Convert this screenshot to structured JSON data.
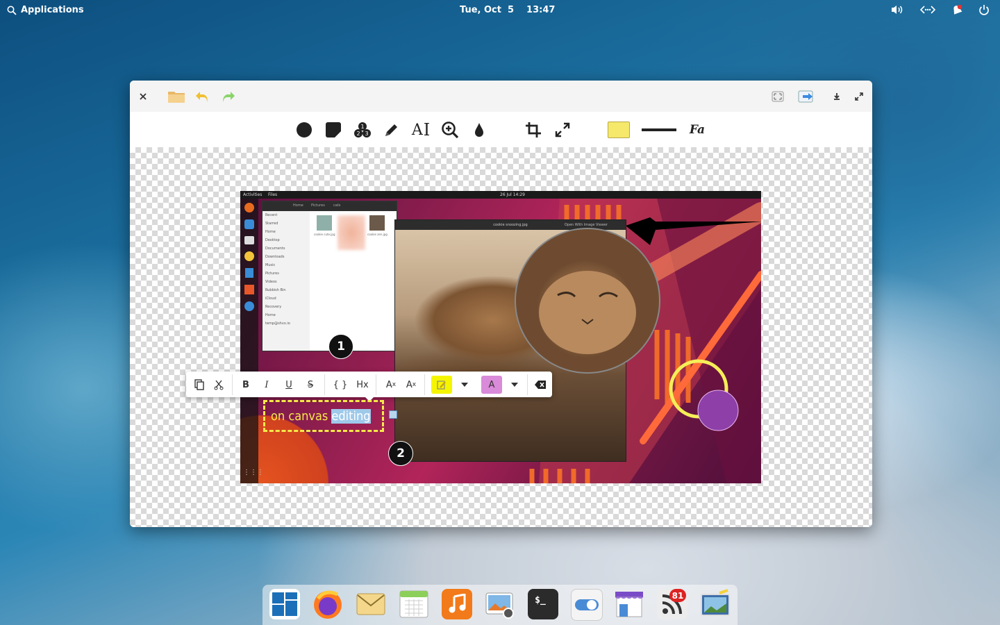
{
  "panel": {
    "applications_label": "Applications",
    "date": "Tue, Oct  5",
    "time": "13:47",
    "icons": [
      "search-icon",
      "volume-icon",
      "network-icon",
      "notifications-icon",
      "power-icon"
    ]
  },
  "window": {
    "headerbar_icons": [
      "close-icon",
      "folder-icon",
      "undo-icon",
      "redo-icon",
      "fit-icon",
      "export-icon",
      "download-icon",
      "fullscreen-icon"
    ],
    "tools": [
      "circle-icon",
      "square-icon",
      "counter-icon",
      "pen-icon",
      "text-icon",
      "magnifier-icon",
      "blur-icon",
      "crop-icon",
      "resize-icon",
      "color-swatch",
      "stroke-width",
      "font-icon"
    ],
    "tool_text_label": "A",
    "font_label": "Fa",
    "primary_color": "#f5e86a"
  },
  "image": {
    "activities": "Activities",
    "files": "Files",
    "clock": "26 Jul  14:29",
    "path": [
      "Home",
      "Pictures",
      "cats"
    ],
    "sidebar": [
      "Recent",
      "Starred",
      "Home",
      "Desktop",
      "Documents",
      "Downloads",
      "Music",
      "Pictures",
      "Videos",
      "Rubbish Bin",
      "iCloud",
      "Recovery",
      "Home",
      "temp@shvx.io"
    ],
    "thumbs": [
      "cookie cute.jpg",
      "",
      "cookie zen.jpg"
    ],
    "viewer_title": "cookie snoozing.jpg",
    "viewer_button": "Open With Image Viewer",
    "badge1": "1",
    "badge2": "2",
    "text_plain": "on canvas",
    "text_selected": "editing"
  },
  "format_toolbar": {
    "copy": "copy-icon",
    "cut": "cut-icon",
    "bold": "B",
    "italic": "I",
    "underline": "U",
    "strike": "S",
    "code": "{ }",
    "heading": "Hx",
    "superscript": "A",
    "superscript_mark": "x",
    "subscript": "A",
    "subscript_mark": "x",
    "highlight_color": "#f5f500",
    "text_color_label": "A",
    "text_color": "#d98ad8"
  },
  "dock": {
    "apps": [
      "multitasking-view",
      "firefox",
      "mail",
      "calendar",
      "music",
      "photos",
      "terminal",
      "system-settings",
      "appcenter",
      "feed-reader",
      "screenshot-tool"
    ],
    "feed_badge": "81"
  }
}
